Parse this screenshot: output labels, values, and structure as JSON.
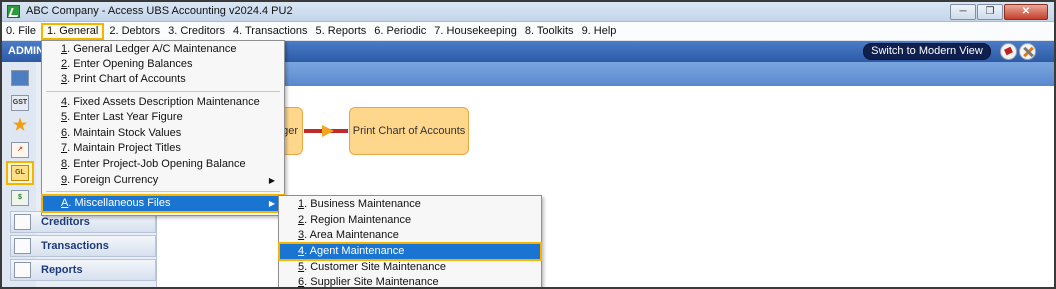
{
  "window": {
    "title": "ABC Company - Access UBS Accounting v2024.4 PU2",
    "min_glyph": "─",
    "max_glyph": "❐",
    "close_glyph": "✕"
  },
  "menubar": [
    {
      "label": "0. File",
      "active": false
    },
    {
      "label": "1. General",
      "active": true
    },
    {
      "label": "2. Debtors",
      "active": false
    },
    {
      "label": "3. Creditors",
      "active": false
    },
    {
      "label": "4. Transactions",
      "active": false
    },
    {
      "label": "5. Reports",
      "active": false
    },
    {
      "label": "6. Periodic",
      "active": false
    },
    {
      "label": "7. Housekeeping",
      "active": false
    },
    {
      "label": "8. Toolkits",
      "active": false
    },
    {
      "label": "9. Help",
      "active": false
    }
  ],
  "header": {
    "user_label": "ADMIN",
    "modern_view_button": "Switch to Modern View"
  },
  "sidebar": {
    "icon_labels": {
      "gst": "GST",
      "gl": "GL"
    },
    "buttons": {
      "creditors": "Creditors",
      "transactions": "Transactions",
      "reports": "Reports"
    }
  },
  "flow": {
    "left_box": "dger",
    "right_box": "Print Chart of Accounts"
  },
  "general_menu": {
    "items": [
      {
        "key": "1",
        "rest": ". General Ledger A/C Maintenance"
      },
      {
        "key": "2",
        "rest": ". Enter Opening Balances"
      },
      {
        "key": "3",
        "rest": ". Print Chart of Accounts"
      },
      {
        "key": "4",
        "rest": ". Fixed Assets Description Maintenance"
      },
      {
        "key": "5",
        "rest": ". Enter Last Year Figure"
      },
      {
        "key": "6",
        "rest": ". Maintain Stock Values"
      },
      {
        "key": "7",
        "rest": ". Maintain Project Titles"
      },
      {
        "key": "8",
        "rest": ". Enter Project-Job Opening Balance"
      },
      {
        "key": "9",
        "rest": ". Foreign Currency"
      },
      {
        "key": "A",
        "rest": ". Miscellaneous Files"
      }
    ]
  },
  "misc_menu": {
    "items": [
      {
        "key": "1",
        "rest": ". Business Maintenance"
      },
      {
        "key": "2",
        "rest": ". Region Maintenance"
      },
      {
        "key": "3",
        "rest": ". Area Maintenance"
      },
      {
        "key": "4",
        "rest": ". Agent Maintenance"
      },
      {
        "key": "5",
        "rest": ". Customer Site Maintenance"
      },
      {
        "key": "6",
        "rest": ". Supplier Site Maintenance"
      }
    ]
  },
  "colors": {
    "accent_highlight": "#f4b400",
    "selection": "#1a74d2",
    "header_blue": "#2c5aa6"
  }
}
